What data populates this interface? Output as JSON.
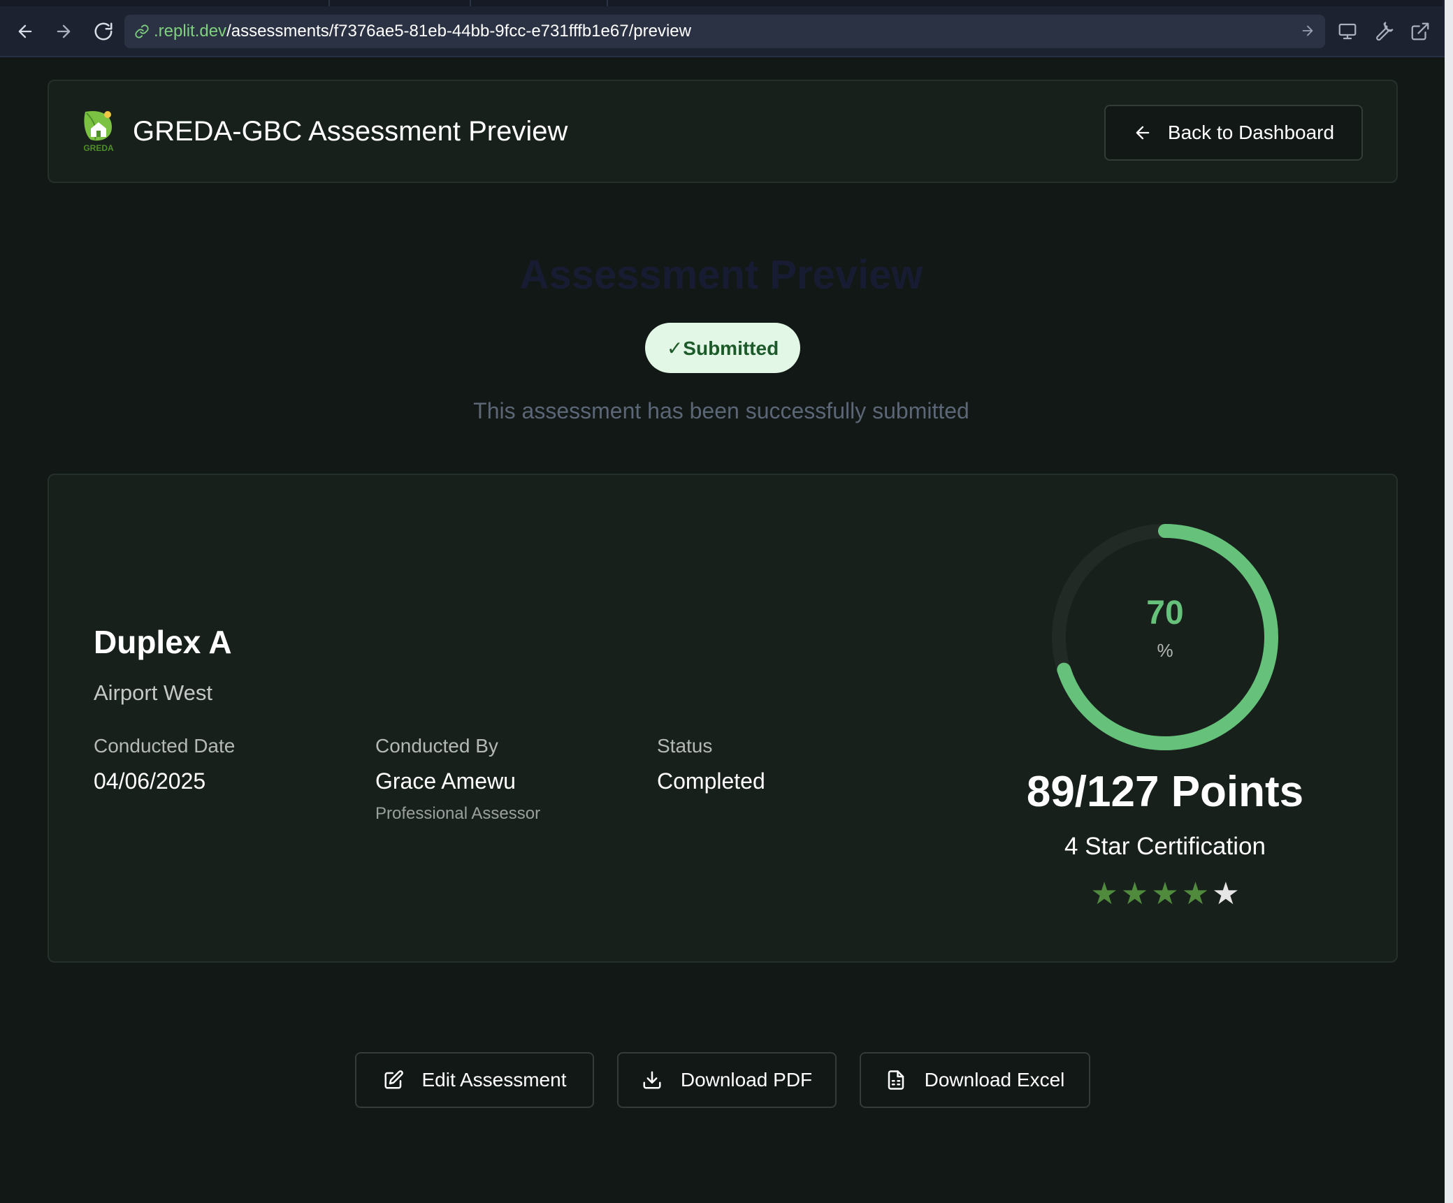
{
  "browser": {
    "url_domain": ".replit.dev",
    "url_path": "/assessments/f7376ae5-81eb-44bb-9fcc-e731fffb1e67/preview"
  },
  "header": {
    "logo_text": "GREDA",
    "title": "GREDA-GBC Assessment Preview",
    "back_button": "Back to Dashboard"
  },
  "page": {
    "heading": "Assessment Preview",
    "badge": "✓Submitted",
    "message": "This assessment has been successfully submitted"
  },
  "assessment": {
    "project_name": "Duplex A",
    "location": "Airport West",
    "conducted_date_label": "Conducted Date",
    "conducted_date": "04/06/2025",
    "conducted_by_label": "Conducted By",
    "conducted_by": "Grace Amewu",
    "assessor_role": "Professional Assessor",
    "status_label": "Status",
    "status": "Completed"
  },
  "score": {
    "percent": "70",
    "percent_fraction": 0.7,
    "unit": "%",
    "points": "89/127 Points",
    "certification": "4 Star Certification",
    "stars_filled": 4,
    "stars_total": 5
  },
  "actions": {
    "edit": "Edit Assessment",
    "pdf": "Download PDF",
    "excel": "Download Excel"
  },
  "colors": {
    "accent_green": "#66c17b",
    "star_filled": "#4f8a3d",
    "star_empty": "#e6e6e6",
    "badge_bg": "#e3f7e6",
    "badge_text": "#1c5a2a"
  }
}
